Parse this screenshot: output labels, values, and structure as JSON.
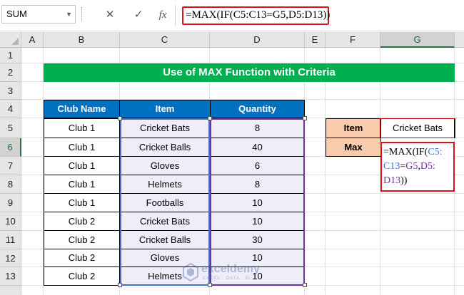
{
  "formula_bar": {
    "name_box": "SUM",
    "cancel_icon": "✕",
    "enter_icon": "✓",
    "fx_label": "fx",
    "formula": "=MAX(IF(C5:C13=G5,D5:D13))"
  },
  "columns": [
    "A",
    "B",
    "C",
    "D",
    "E",
    "F",
    "G"
  ],
  "rows": [
    "1",
    "2",
    "3",
    "4",
    "5",
    "6",
    "7",
    "8",
    "9",
    "10",
    "11",
    "12",
    "13"
  ],
  "banner": "Use of MAX Function with Criteria",
  "table": {
    "headers": [
      "Club Name",
      "Item",
      "Quantity"
    ],
    "rows": [
      [
        "Club 1",
        "Cricket Bats",
        "8"
      ],
      [
        "Club 1",
        "Cricket Balls",
        "40"
      ],
      [
        "Club 1",
        "Gloves",
        "6"
      ],
      [
        "Club 1",
        "Helmets",
        "8"
      ],
      [
        "Club 1",
        "Footballs",
        "10"
      ],
      [
        "Club 2",
        "Cricket Bats",
        "10"
      ],
      [
        "Club 2",
        "Cricket Balls",
        "30"
      ],
      [
        "Club 2",
        "Gloves",
        "10"
      ],
      [
        "Club 2",
        "Helmets",
        "10"
      ]
    ]
  },
  "criteria": {
    "item_label": "Item",
    "item_value": "Cricket Bats",
    "max_label": "Max",
    "max_formula_parts": [
      "=MAX(IF(",
      "C5:",
      "C13",
      "=",
      "G5",
      ",",
      "D5:",
      "D13",
      "))"
    ]
  },
  "watermark": {
    "title": "exceldemy",
    "subtitle": "EXCEL · DATA · BI"
  },
  "colors": {
    "banner": "#00b050",
    "header": "#0070c0",
    "label": "#f8cbad",
    "formula_border": "#e0101a"
  }
}
